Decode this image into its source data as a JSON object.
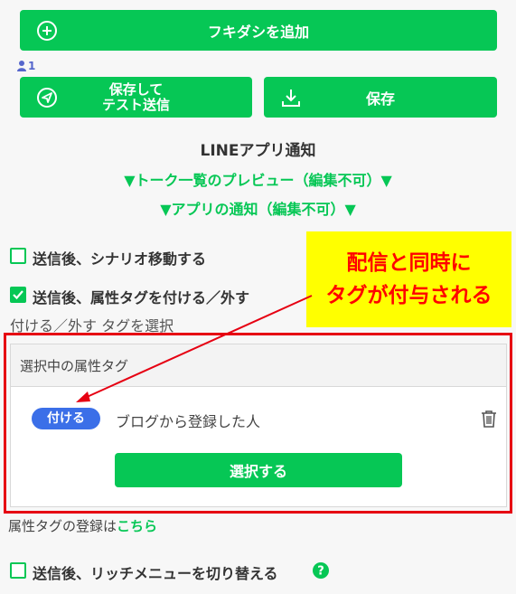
{
  "actions": {
    "add_bubble_label": "フキダシを追加",
    "user_count": "1",
    "save_and_test_label_line1": "保存して",
    "save_and_test_label_line2": "テスト送信",
    "save_label": "保存"
  },
  "notification": {
    "title": "LINEアプリ通知",
    "talk_preview": "▼トーク一覧のプレビュー（編集不可）▼",
    "app_notification": "▼アプリの通知（編集不可）▼"
  },
  "options": {
    "scenario_move": "送信後、シナリオ移動する",
    "tag_toggle": "送信後、属性タグを付ける／外す",
    "tag_select_label": "付ける／外す タグを選択",
    "rich_menu_switch": "送信後、リッチメニューを切り替える"
  },
  "tag_panel": {
    "header": "選択中の属性タグ",
    "badge": "付ける",
    "tag_name": "ブログから登録した人",
    "select_button": "選択する"
  },
  "tag_register": {
    "prefix": "属性タグの登録は",
    "link": "こちら"
  },
  "annotation": {
    "line1": "配信と同時に",
    "line2": "タグが付与される"
  },
  "state": {
    "scenario_move_checked": false,
    "tag_toggle_checked": true,
    "rich_menu_checked": false
  },
  "colors": {
    "accent": "#06c755",
    "annotation_bg": "#ffff00",
    "annotation_text": "#ff0000",
    "highlight_border": "#e60012",
    "badge": "#3b6fe8"
  }
}
